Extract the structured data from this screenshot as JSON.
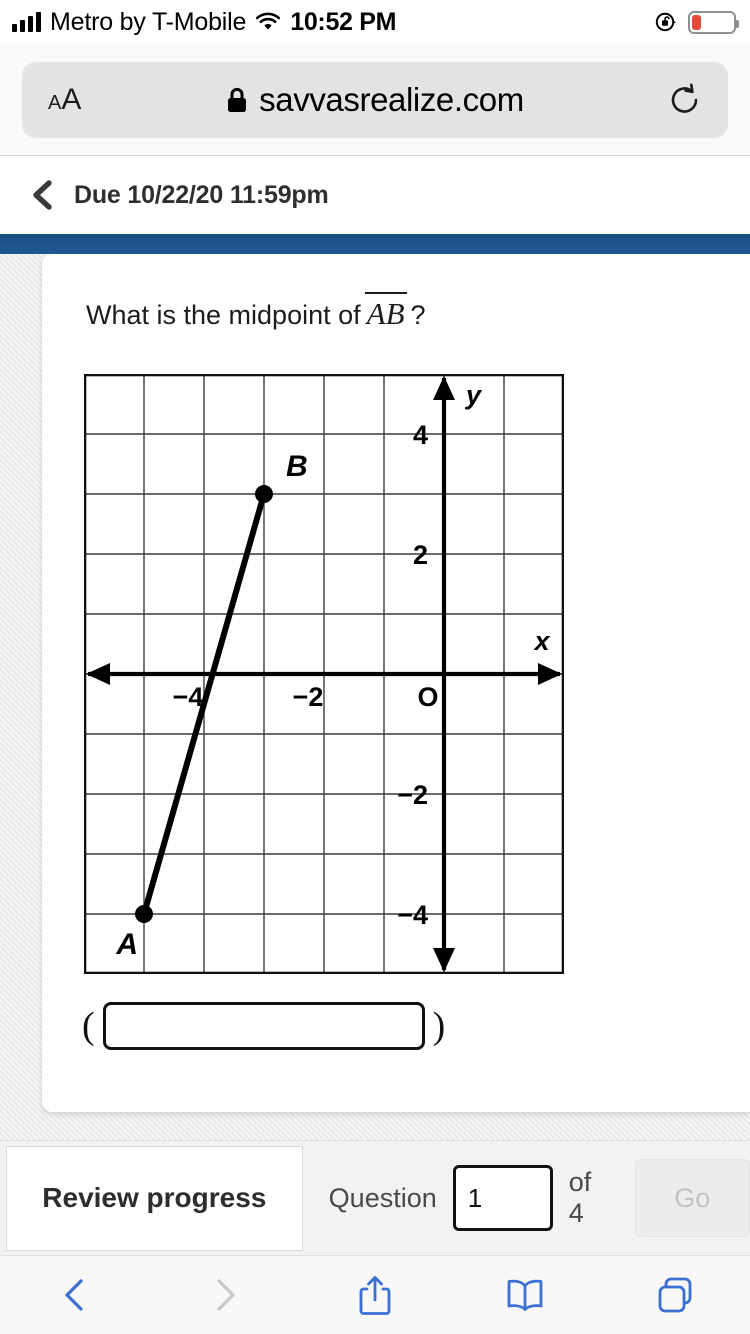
{
  "status_bar": {
    "carrier": "Metro by T-Mobile",
    "time": "10:52 PM",
    "signal_icon": "cellular-bars-icon",
    "wifi_icon": "wifi-icon",
    "rotation_lock_icon": "rotation-lock-icon",
    "battery_icon": "battery-low-icon",
    "battery_percent": 20,
    "battery_color": "#e8493a"
  },
  "browser": {
    "text_size_label_small": "A",
    "text_size_label_large": "A",
    "lock_icon": "lock-icon",
    "url": "savvasrealize.com",
    "reload_icon": "reload-icon",
    "toolbar": {
      "back_icon": "chevron-left-icon",
      "forward_icon": "chevron-right-icon",
      "share_icon": "share-icon",
      "bookmarks_icon": "book-icon",
      "tabs_icon": "tabs-icon",
      "back_enabled_color": "#3b6fd4",
      "forward_disabled_color": "#c7c7cc",
      "accent_color": "#3b6fd4"
    }
  },
  "assignment_bar": {
    "back_icon": "chevron-left-icon",
    "due_text": "Due 10/22/20 11:59pm"
  },
  "app_header": {
    "color": "#1f5992"
  },
  "question": {
    "prompt_prefix": "What is the midpoint of",
    "segment_label": "AB",
    "prompt_suffix": "?",
    "answer_open_paren": "(",
    "answer_close_paren": ")",
    "answer_value": "",
    "answer_placeholder": ""
  },
  "chart_data": {
    "type": "scatter",
    "title": "",
    "xlabel": "x",
    "ylabel": "y",
    "xlim": [
      -6,
      2
    ],
    "ylim": [
      -5,
      5
    ],
    "grid": true,
    "x_tick_labels": [
      {
        "value": -4,
        "label": "−4"
      },
      {
        "value": -2,
        "label": "−2"
      },
      {
        "value": 0,
        "label": "O"
      }
    ],
    "y_tick_labels": [
      {
        "value": 4,
        "label": "4"
      },
      {
        "value": 2,
        "label": "2"
      },
      {
        "value": -2,
        "label": "−2"
      },
      {
        "value": -4,
        "label": "−4"
      }
    ],
    "points": [
      {
        "name": "A",
        "x": -5,
        "y": -4,
        "label_position": "below-left"
      },
      {
        "name": "B",
        "x": -3,
        "y": 3,
        "label_position": "above-right"
      }
    ],
    "segments": [
      {
        "from": "A",
        "to": "B"
      }
    ],
    "axis_arrows": true,
    "grid_step": 1
  },
  "footer": {
    "review_label": "Review progress",
    "question_label": "Question",
    "question_number": "1",
    "of_label": "of 4",
    "go_label": "Go"
  }
}
